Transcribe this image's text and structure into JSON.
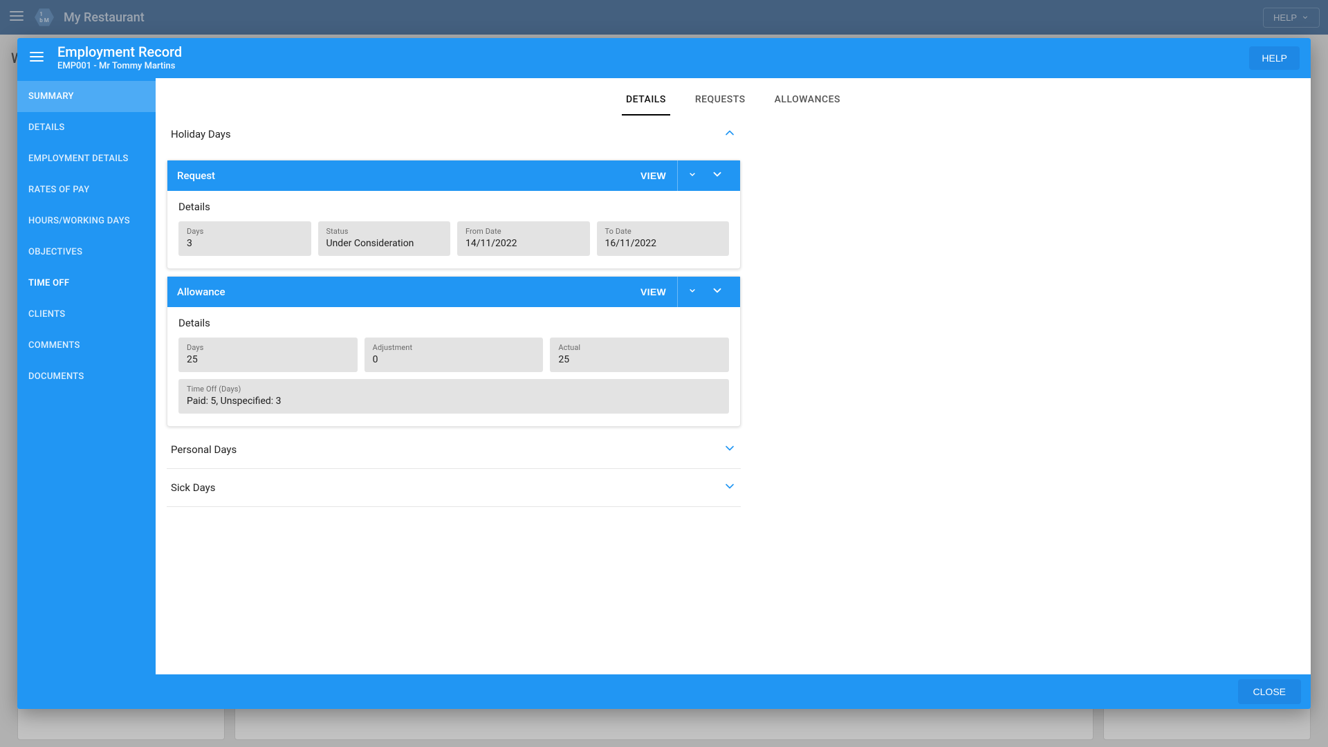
{
  "colors": {
    "primary": "#2196f3",
    "primaryDark": "#1e88e5",
    "topbar": "#1b4d85"
  },
  "topbar": {
    "title": "My Restaurant",
    "help": "HELP"
  },
  "backdrop_letter": "W",
  "dialog": {
    "title": "Employment Record",
    "subtitle": "EMP001 - Mr Tommy Martins",
    "help": "HELP",
    "close": "CLOSE"
  },
  "sidebar": {
    "items": [
      {
        "label": "SUMMARY",
        "state": "active"
      },
      {
        "label": "DETAILS",
        "state": "dim"
      },
      {
        "label": "EMPLOYMENT DETAILS",
        "state": "dim"
      },
      {
        "label": "RATES OF PAY",
        "state": "dim"
      },
      {
        "label": "HOURS/WORKING DAYS",
        "state": "dim"
      },
      {
        "label": "OBJECTIVES",
        "state": "dim"
      },
      {
        "label": "TIME OFF",
        "state": "strong"
      },
      {
        "label": "CLIENTS",
        "state": "dim"
      },
      {
        "label": "COMMENTS",
        "state": "dim"
      },
      {
        "label": "DOCUMENTS",
        "state": "dim"
      }
    ]
  },
  "tabs": {
    "items": [
      {
        "label": "DETAILS",
        "active": true
      },
      {
        "label": "REQUESTS",
        "active": false
      },
      {
        "label": "ALLOWANCES",
        "active": false
      }
    ]
  },
  "sections": {
    "holiday": {
      "title": "Holiday Days",
      "expanded": true
    },
    "personal": {
      "title": "Personal Days",
      "expanded": false
    },
    "sick": {
      "title": "Sick Days",
      "expanded": false
    }
  },
  "request_card": {
    "title": "Request",
    "view": "VIEW",
    "details_label": "Details",
    "fields": {
      "days": {
        "label": "Days",
        "value": "3"
      },
      "status": {
        "label": "Status",
        "value": "Under Consideration"
      },
      "from": {
        "label": "From Date",
        "value": "14/11/2022"
      },
      "to": {
        "label": "To Date",
        "value": "16/11/2022"
      }
    }
  },
  "allowance_card": {
    "title": "Allowance",
    "view": "VIEW",
    "details_label": "Details",
    "fields": {
      "days": {
        "label": "Days",
        "value": "25"
      },
      "adjustment": {
        "label": "Adjustment",
        "value": "0"
      },
      "actual": {
        "label": "Actual",
        "value": "25"
      },
      "timeoff": {
        "label": "Time Off (Days)",
        "value": "Paid: 5, Unspecified: 3"
      }
    }
  }
}
